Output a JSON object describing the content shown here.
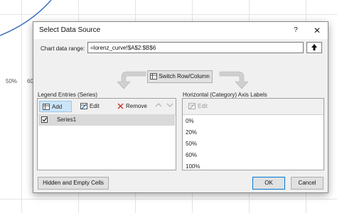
{
  "background": {
    "axis_labels": [
      "50%",
      "60"
    ]
  },
  "dialog": {
    "title": "Select Data Source",
    "help_glyph": "?",
    "close_glyph": "✕",
    "chart_data_range_label": "Chart data range:",
    "chart_data_range_value": "=lorenz_curve!$A$2:$B$6",
    "switch_label": "Switch Row/Column",
    "legend": {
      "label": "Legend Entries (Series)",
      "add_label": "Add",
      "edit_label": "Edit",
      "remove_label": "Remove",
      "series": [
        "Series1"
      ]
    },
    "axis": {
      "label": "Horizontal (Category) Axis Labels",
      "edit_label": "Edit",
      "items": [
        "0%",
        "20%",
        "50%",
        "60%",
        "100%"
      ]
    },
    "hidden_empty_label": "Hidden and Empty Cells",
    "ok_label": "OK",
    "cancel_label": "Cancel"
  }
}
